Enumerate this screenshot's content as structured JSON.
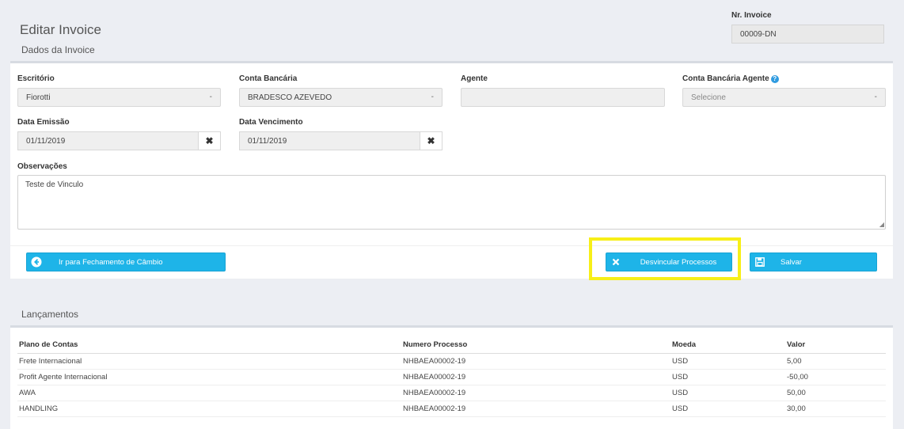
{
  "header": {
    "title": "Editar Invoice",
    "subtitle": "Dados da Invoice",
    "nr_invoice_label": "Nr. Invoice",
    "nr_invoice_value": "00009-DN"
  },
  "form": {
    "escritorio": {
      "label": "Escritório",
      "value": "Fiorotti"
    },
    "conta_bancaria": {
      "label": "Conta Bancária",
      "value": "BRADESCO AZEVEDO"
    },
    "agente": {
      "label": "Agente",
      "value": ""
    },
    "conta_bancaria_agente": {
      "label": "Conta Bancária Agente",
      "placeholder": "Selecione"
    },
    "data_emissao": {
      "label": "Data Emissão",
      "value": "01/11/2019"
    },
    "data_vencimento": {
      "label": "Data Vencimento",
      "value": "01/11/2019"
    },
    "observacoes": {
      "label": "Observações",
      "value": "Teste de Vinculo"
    },
    "caret": "-",
    "clear_glyph": "✖"
  },
  "actions": {
    "fechamento_label": "Ir para Fechamento de Câmbio",
    "desvincular_label": "Desvincular Processos",
    "salvar_label": "Salvar",
    "highlight_color": "#f7ef18",
    "button_color": "#1eb4e8"
  },
  "lancamentos": {
    "title": "Lançamentos",
    "columns": [
      "Plano de Contas",
      "Numero Processo",
      "Moeda",
      "Valor"
    ],
    "rows": [
      [
        "Frete Internacional",
        "NHBAEA00002-19",
        "USD",
        "5,00"
      ],
      [
        "Profit Agente Internacional",
        "NHBAEA00002-19",
        "USD",
        "-50,00"
      ],
      [
        "AWA",
        "NHBAEA00002-19",
        "USD",
        "50,00"
      ],
      [
        "HANDLING",
        "NHBAEA00002-19",
        "USD",
        "30,00"
      ]
    ]
  }
}
